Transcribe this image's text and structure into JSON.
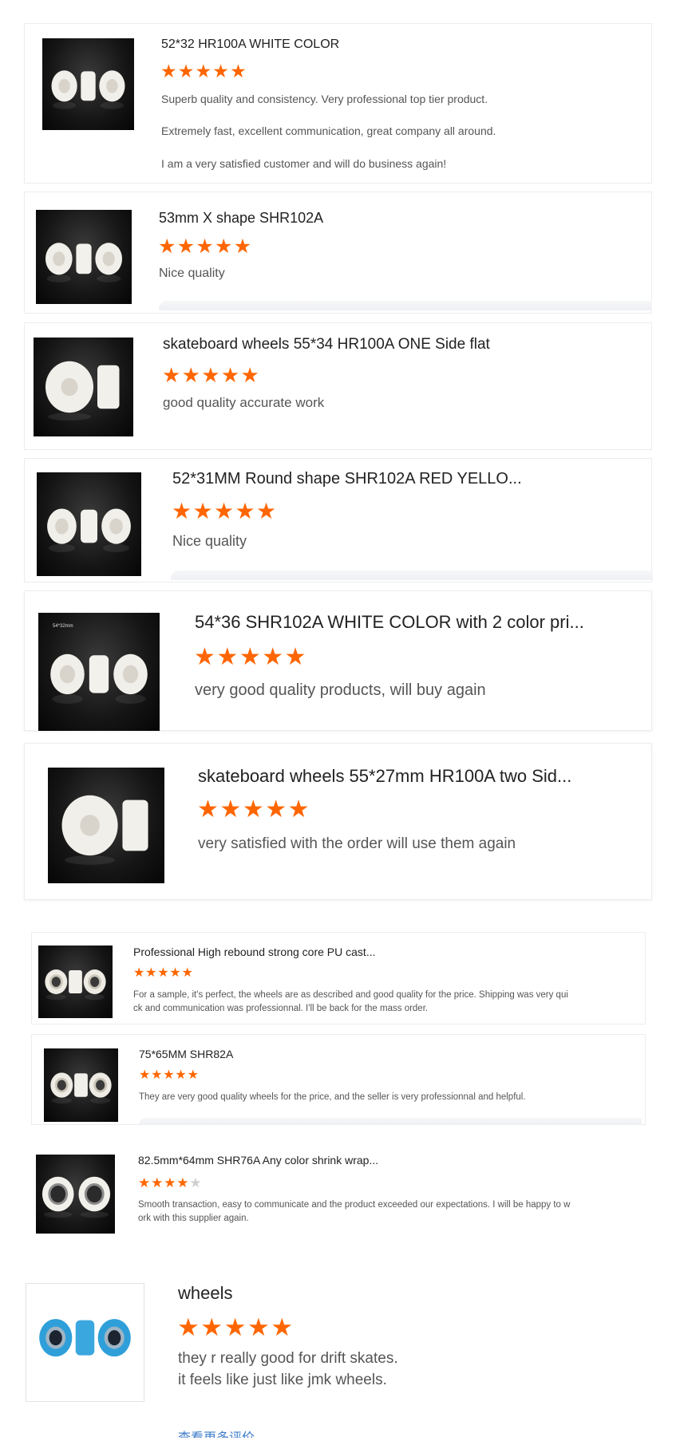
{
  "colors": {
    "star_on": "#ff6600",
    "star_off": "#cfcfcf"
  },
  "reviews": [
    {
      "title": "52*32 HR100A WHITE COLOR",
      "rating": 5,
      "text": [
        "Superb quality and consistency. Very professional top tier product.",
        "Extremely fast, excellent communication, great company all around.",
        "I am a very satisfied customer and will do business again!"
      ]
    },
    {
      "title": "53mm X shape SHR102A",
      "rating": 5,
      "text": [
        "Nice quality"
      ]
    },
    {
      "title": "skateboard wheels 55*34 HR100A ONE Side flat",
      "rating": 5,
      "text": [
        "good quality accurate work"
      ]
    },
    {
      "title": "52*31MM Round shape SHR102A RED YELLO...",
      "rating": 5,
      "text": [
        "Nice quality"
      ]
    },
    {
      "title": "54*36 SHR102A WHITE COLOR with 2 color pri...",
      "rating": 5,
      "text": [
        "very good quality products, will buy again"
      ],
      "image_label": "54*32mm"
    },
    {
      "title": "skateboard wheels 55*27mm HR100A two Sid...",
      "rating": 5,
      "text": [
        "very satisfied with the order will use them again"
      ]
    },
    {
      "title": "Professional High rebound strong core PU cast...",
      "rating": 5,
      "text": [
        "For a sample, it's perfect, the wheels are as described and good quality for the price. Shipping was very qui",
        "ck and communication was professionnal. I'll be back for the mass order."
      ]
    },
    {
      "title": "75*65MM SHR82A",
      "rating": 5,
      "text": [
        "They are very good quality wheels for the price, and the seller is very professionnal and helpful."
      ]
    },
    {
      "title": "82.5mm*64mm SHR76A Any color shrink wrap...",
      "rating": 4,
      "text": [
        "Smooth transaction, easy to communicate and the product exceeded our expectations. I will be happy to w",
        "ork with this supplier again."
      ]
    },
    {
      "title": "wheels",
      "rating": 5,
      "text": [
        "they r really good for drift skates.",
        "it feels like just like jmk wheels."
      ]
    }
  ],
  "footer": {
    "link_text": "查看更多评价"
  }
}
